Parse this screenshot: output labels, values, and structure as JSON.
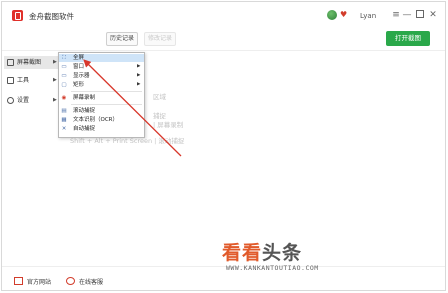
{
  "window": {
    "title": "金舟截图软件",
    "username": "Lyan",
    "controls": {
      "menu": "≡",
      "minimize": "—",
      "close": "✕"
    }
  },
  "toolbar": {
    "history": "历史记录",
    "edit": "修改记录",
    "open_screenshot": "打开截图"
  },
  "sidebar": {
    "items": [
      {
        "label": "屏幕截图",
        "icon": "screenshot-icon",
        "active": true
      },
      {
        "label": "工具",
        "icon": "toolbox-icon",
        "active": false
      },
      {
        "label": "设置",
        "icon": "settings-icon",
        "active": false
      }
    ]
  },
  "menu": {
    "items": [
      {
        "label": "全屏",
        "icon": "fullscreen-icon",
        "has_submenu": false,
        "highlighted": true
      },
      {
        "label": "窗口",
        "icon": "window-icon",
        "has_submenu": true,
        "highlighted": false
      },
      {
        "label": "显示器",
        "icon": "monitor-icon",
        "has_submenu": true,
        "highlighted": false
      },
      {
        "label": "矩形",
        "icon": "rectangle-icon",
        "has_submenu": true,
        "highlighted": false
      },
      {
        "label": "屏幕录制",
        "icon": "record-icon",
        "has_submenu": false,
        "highlighted": false
      },
      {
        "label": "滚动捕捉",
        "icon": "scroll-capture-icon",
        "has_submenu": false,
        "highlighted": false
      },
      {
        "label": "文本识别（OCR）",
        "icon": "ocr-icon",
        "has_submenu": false,
        "highlighted": false
      },
      {
        "label": "自动捕捉",
        "icon": "auto-capture-icon",
        "has_submenu": false,
        "highlighted": false
      }
    ]
  },
  "hints": {
    "line1": "区域",
    "line2": "捕捉",
    "line3": "| 屏幕录制",
    "line4": "Shift + Alt + Print Screen | 滚动捕捉"
  },
  "footer": {
    "official_site": "官方网站",
    "online_service": "在线客服"
  },
  "watermark": {
    "part1": "看看",
    "part2": "头条",
    "url": "WWW.KANKANTOUTIAO.COM"
  },
  "colors": {
    "accent_green": "#2aa84a",
    "brand_red": "#e0302a",
    "menu_highlight": "#cfe4f8",
    "annotation_arrow": "#d8372b"
  }
}
